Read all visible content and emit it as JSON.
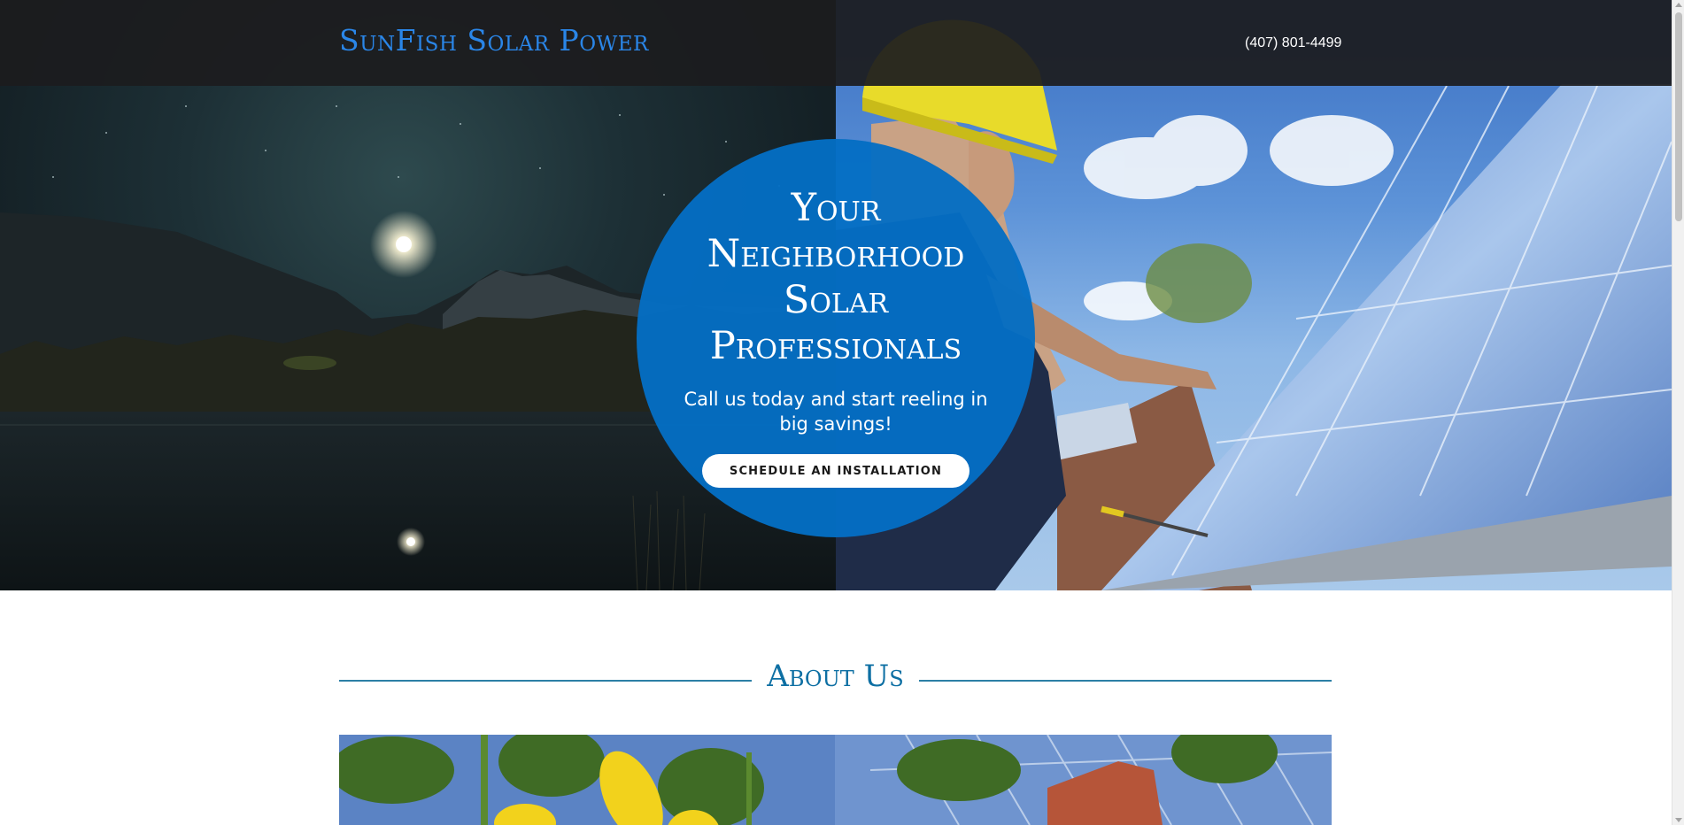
{
  "header": {
    "logo": "SunFish Solar Power",
    "phone": "(407) 801-4499"
  },
  "hero": {
    "title": "Your Neighborhood Solar Professionals",
    "subtitle": "Call us today and start reeling in big savings!",
    "cta_label": "SCHEDULE AN INSTALLATION",
    "left_image": "night-lake-photo",
    "right_image": "solar-installer-photo"
  },
  "about": {
    "heading": "About Us",
    "image": "sunflower-solar-panel-photo"
  },
  "colors": {
    "brand_blue": "#046ec4",
    "logo_blue": "#2a86e8",
    "header_bg": "#1c1c1e",
    "accent_line": "#2c7fa6"
  }
}
